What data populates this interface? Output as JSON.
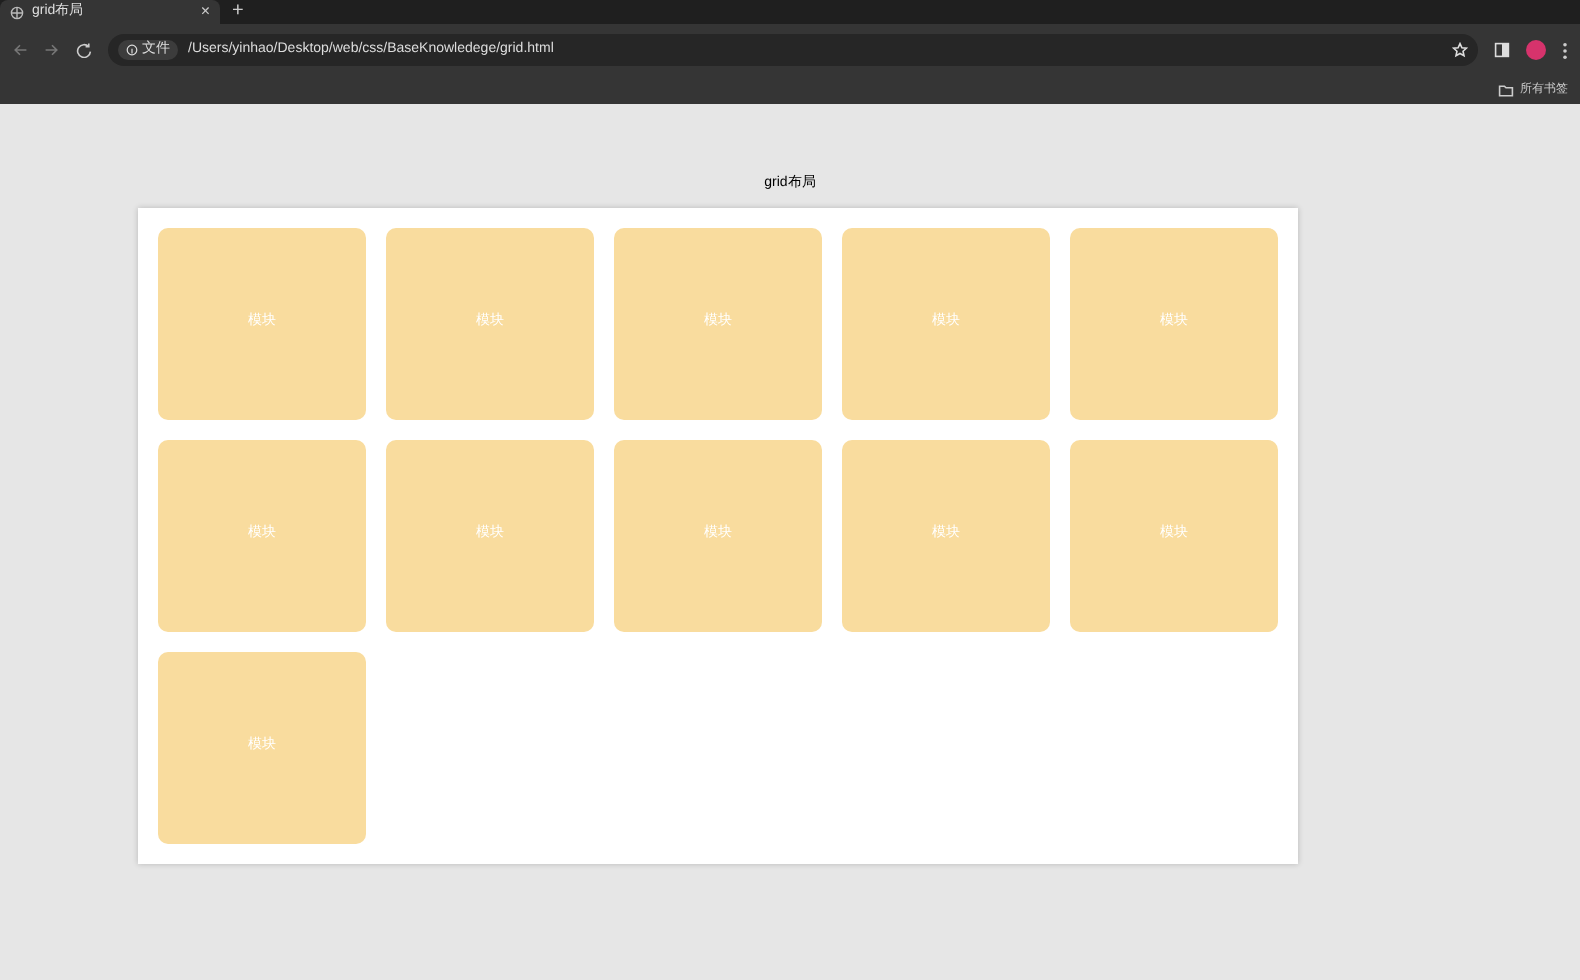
{
  "browser": {
    "tab": {
      "title": "grid布局",
      "close": "×"
    },
    "new_tab": "+",
    "address": {
      "chip": "文件",
      "url": "/Users/yinhao/Desktop/web/css/BaseKnowledege/grid.html"
    },
    "bookmarks": {
      "label": "所有书签"
    }
  },
  "page": {
    "title": "grid布局",
    "items": [
      {
        "label": "模块"
      },
      {
        "label": "模块"
      },
      {
        "label": "模块"
      },
      {
        "label": "模块"
      },
      {
        "label": "模块"
      },
      {
        "label": "模块"
      },
      {
        "label": "模块"
      },
      {
        "label": "模块"
      },
      {
        "label": "模块"
      },
      {
        "label": "模块"
      },
      {
        "label": "模块"
      }
    ]
  }
}
